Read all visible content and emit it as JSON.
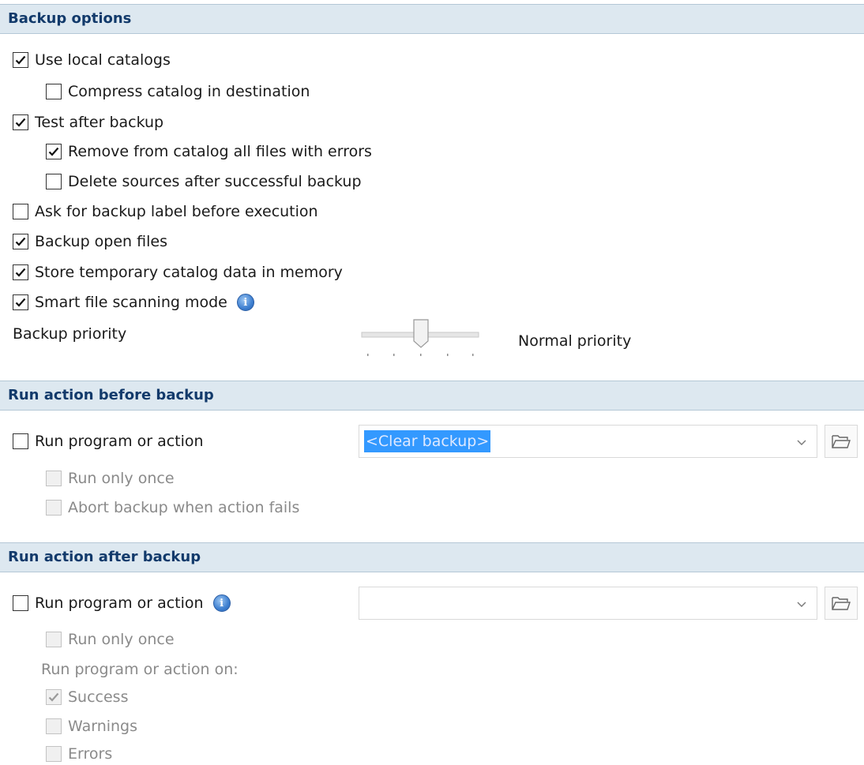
{
  "backup_options": {
    "title": "Backup options",
    "use_local_catalogs": {
      "label": "Use local catalogs",
      "checked": true
    },
    "compress_catalog": {
      "label": "Compress catalog in destination",
      "checked": false
    },
    "test_after_backup": {
      "label": "Test after backup",
      "checked": true
    },
    "remove_files_with_errors": {
      "label": "Remove from catalog all files with errors",
      "checked": true
    },
    "delete_sources": {
      "label": "Delete sources after successful backup",
      "checked": false
    },
    "ask_backup_label": {
      "label": "Ask for backup label before execution",
      "checked": false
    },
    "backup_open_files": {
      "label": "Backup open files",
      "checked": true
    },
    "store_temp_catalog": {
      "label": "Store temporary catalog data in memory",
      "checked": true
    },
    "smart_scanning": {
      "label": "Smart file scanning mode",
      "checked": true
    },
    "priority": {
      "label": "Backup priority",
      "value_text": "Normal priority",
      "level": 2,
      "levels": 5
    }
  },
  "run_before": {
    "title": "Run action before backup",
    "run_program": {
      "label": "Run program or action",
      "checked": false
    },
    "program_value": "<Clear backup>",
    "run_only_once": {
      "label": "Run only once",
      "checked": false,
      "disabled": true
    },
    "abort_on_fail": {
      "label": "Abort backup when action fails",
      "checked": false,
      "disabled": true
    }
  },
  "run_after": {
    "title": "Run action after backup",
    "run_program": {
      "label": "Run program or action",
      "checked": false
    },
    "program_value": "",
    "run_only_once": {
      "label": "Run only once",
      "checked": false,
      "disabled": true
    },
    "run_on_label": "Run program or action on:",
    "success": {
      "label": "Success",
      "checked": true,
      "disabled": true
    },
    "warnings": {
      "label": "Warnings",
      "checked": false,
      "disabled": true
    },
    "errors": {
      "label": "Errors",
      "checked": false,
      "disabled": true
    }
  }
}
